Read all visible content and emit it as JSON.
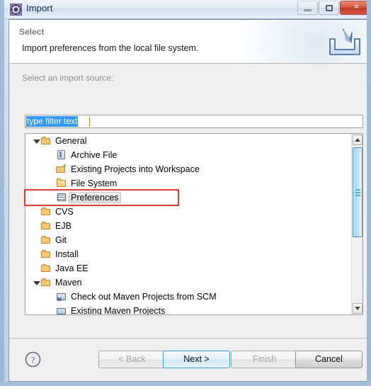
{
  "window": {
    "title": "Import",
    "icon": "eclipse-import-icon",
    "controls": {
      "minimize": "minimize-button",
      "maximize": "maximize-button",
      "close": "×"
    }
  },
  "header": {
    "title": "Select",
    "description": "Import preferences from the local file system.",
    "icon": "import-tray-icon"
  },
  "body": {
    "source_label": "Select an import source:",
    "filter": {
      "value": "type filter text",
      "placeholder": "type filter text",
      "selected": true
    }
  },
  "tree": {
    "rows": [
      {
        "label": "General",
        "indent": 0,
        "twisty": "expanded",
        "icon": "folder-open-icon",
        "selected": false
      },
      {
        "label": "Archive File",
        "indent": 1,
        "twisty": "none",
        "icon": "archive-file-icon",
        "selected": false
      },
      {
        "label": "Existing Projects into Workspace",
        "indent": 1,
        "twisty": "none",
        "icon": "existing-projects-icon",
        "selected": false
      },
      {
        "label": "File System",
        "indent": 1,
        "twisty": "none",
        "icon": "folder-icon",
        "selected": false
      },
      {
        "label": "Preferences",
        "indent": 1,
        "twisty": "none",
        "icon": "preferences-icon",
        "selected": true
      },
      {
        "label": "CVS",
        "indent": 0,
        "twisty": "collapsed",
        "icon": "folder-open-icon",
        "selected": false
      },
      {
        "label": "EJB",
        "indent": 0,
        "twisty": "collapsed",
        "icon": "folder-open-icon",
        "selected": false
      },
      {
        "label": "Git",
        "indent": 0,
        "twisty": "collapsed",
        "icon": "folder-open-icon",
        "selected": false
      },
      {
        "label": "Install",
        "indent": 0,
        "twisty": "collapsed",
        "icon": "folder-open-icon",
        "selected": false
      },
      {
        "label": "Java EE",
        "indent": 0,
        "twisty": "collapsed",
        "icon": "folder-open-icon",
        "selected": false
      },
      {
        "label": "Maven",
        "indent": 0,
        "twisty": "expanded",
        "icon": "folder-open-icon",
        "selected": false
      },
      {
        "label": "Check out Maven Projects from SCM",
        "indent": 1,
        "twisty": "none",
        "icon": "maven-scm-icon",
        "selected": false
      },
      {
        "label": "Existing Maven Projects",
        "indent": 1,
        "twisty": "none",
        "icon": "maven-project-icon",
        "selected": false
      }
    ],
    "scrollbar": {
      "up": "scroll-up-arrow",
      "down": "scroll-down-arrow",
      "thumb_position_pct": 7
    }
  },
  "annotation": {
    "color": "#e03a34",
    "target": "Preferences"
  },
  "footer": {
    "help": "?",
    "buttons": [
      {
        "id": "back",
        "label": "< Back",
        "state": "disabled"
      },
      {
        "id": "next",
        "label": "Next >",
        "state": "default"
      },
      {
        "id": "finish",
        "label": "Finish",
        "state": "disabled"
      },
      {
        "id": "cancel",
        "label": "Cancel",
        "state": "normal"
      }
    ]
  }
}
